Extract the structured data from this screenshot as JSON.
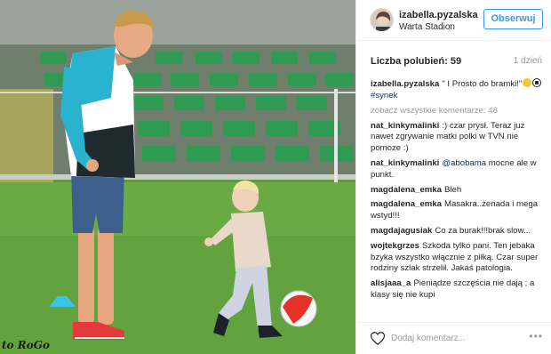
{
  "header": {
    "username": "izabella.pyzalska",
    "location": "Warta Stadion",
    "follow_label": "Obserwuj"
  },
  "stats": {
    "likes_label": "Liczba polubień: 59",
    "age": "1 dzień"
  },
  "caption": {
    "username": "izabella.pyzalska",
    "text": "\" I Prosto do bramki!\"",
    "hashtag": "#synek"
  },
  "view_all_label": "zobacz wszystkie komentarze: 48",
  "comments": [
    {
      "user": "nat_kinkymalinki",
      "text": ":) czar prysł. Teraz juz nawet zgrywanie matki polki w TVN nie pomoze :)"
    },
    {
      "user": "nat_kinkymalinki",
      "mention": "@abobama",
      "text": " mocne ale w punkt."
    },
    {
      "user": "magdalena_emka",
      "text": "Bleh"
    },
    {
      "user": "magdalena_emka",
      "text": "Masakra..żenada i mega wstyd!!!"
    },
    {
      "user": "magdajagusiak",
      "text": "Co za burak!!!brak slow..."
    },
    {
      "user": "wojtekgrzes",
      "text": "Szkoda tylko pani. Ten jebaka bzyka wszystko włącznie z piłką. Czar super rodziny szlak strzelił. Jakaś patologia."
    },
    {
      "user": "alisjaaa_a",
      "text": "Pieniądze szczęścia nie dają ; a klasy się nie kupi"
    }
  ],
  "footer": {
    "comment_placeholder": "Dodaj komentarz...",
    "more_label": "•••"
  },
  "photo": {
    "watermark": "to RoGo"
  },
  "colors": {
    "accent": "#3897f0",
    "text": "#262626",
    "muted": "#999999",
    "link": "#003569"
  }
}
